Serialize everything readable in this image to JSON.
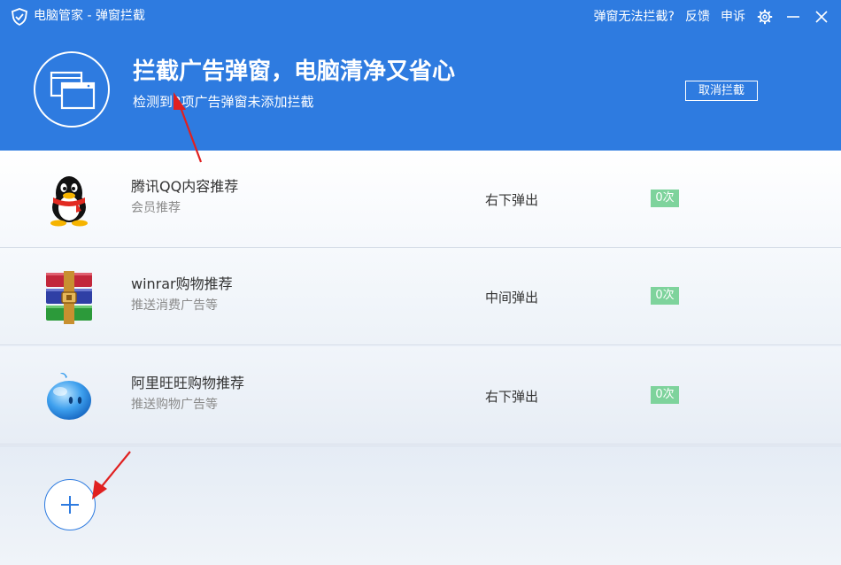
{
  "titlebar": {
    "app_title": "电脑管家 - 弹窗拦截",
    "links": {
      "cant_block": "弹窗无法拦截?",
      "feedback": "反馈",
      "appeal": "申诉"
    },
    "icons": [
      "shield-logo-icon",
      "gear-icon",
      "minimize-icon",
      "close-icon"
    ]
  },
  "banner": {
    "title": "拦截广告弹窗，电脑清净又省心",
    "subtitle": "检测到3项广告弹窗未添加拦截",
    "cancel_label": "取消拦截",
    "icon": "windows-icon"
  },
  "popups": [
    {
      "name": "腾讯QQ内容推荐",
      "desc": "会员推荐",
      "position": "右下弹出",
      "count": "0次",
      "icon": "qq-penguin-icon"
    },
    {
      "name": "winrar购物推荐",
      "desc": "推送消费广告等",
      "position": "中间弹出",
      "count": "0次",
      "icon": "winrar-books-icon"
    },
    {
      "name": "阿里旺旺购物推荐",
      "desc": "推送购物广告等",
      "position": "右下弹出",
      "count": "0次",
      "icon": "aliwangwang-icon"
    }
  ],
  "footer": {
    "add_icon": "plus-icon"
  },
  "colors": {
    "header_blue": "#2e7be0",
    "count_badge": "#7ed39c",
    "annotation_red": "#e02020"
  }
}
